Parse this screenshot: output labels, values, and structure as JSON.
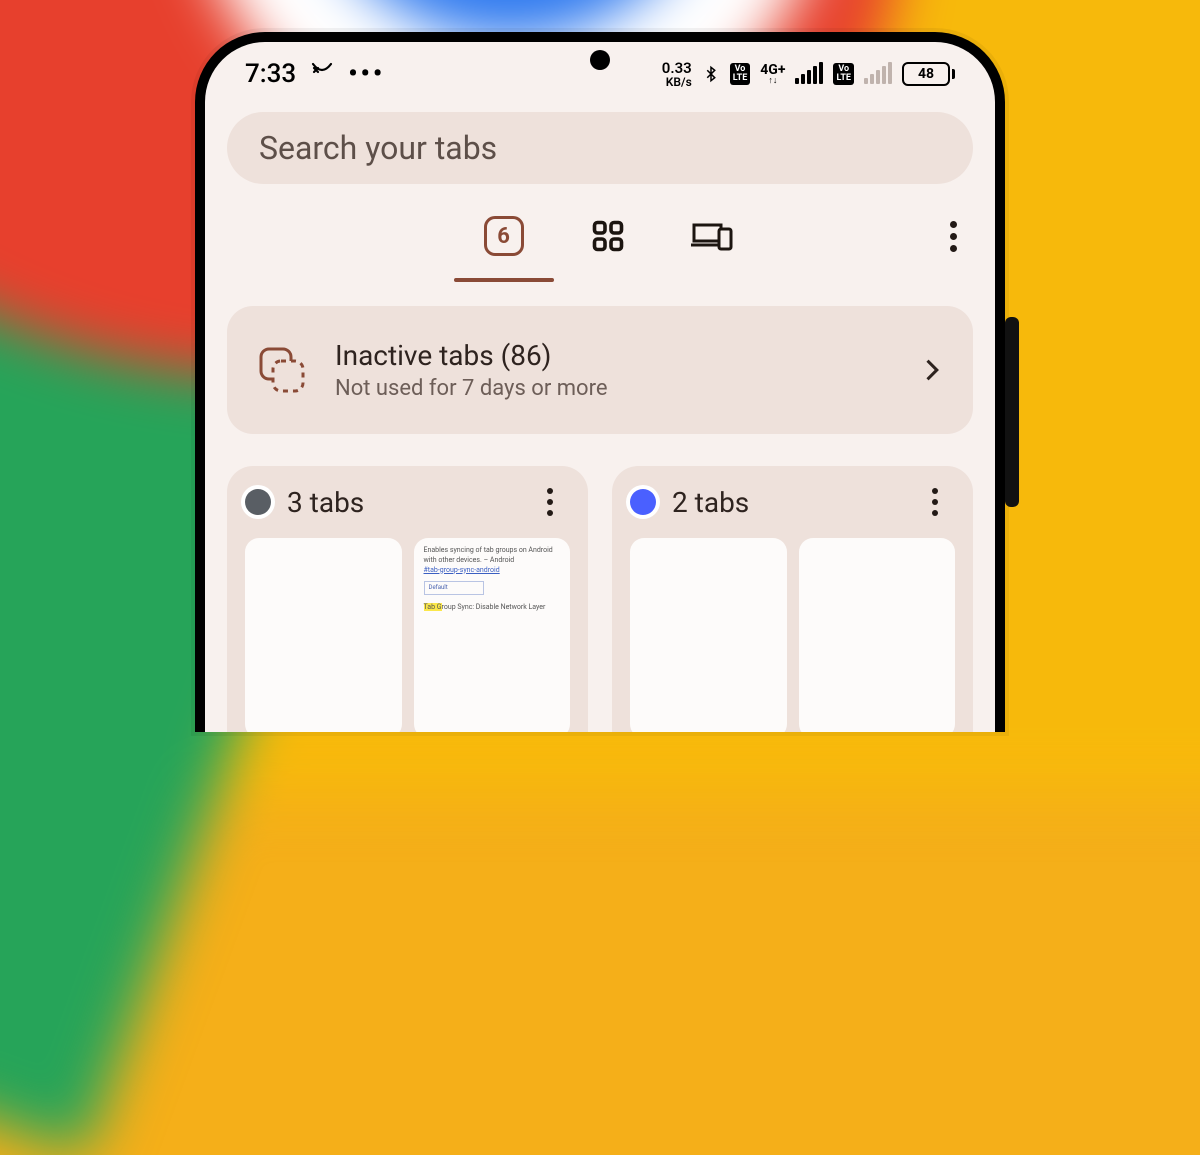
{
  "status": {
    "time": "7:33",
    "data_rate_value": "0.33",
    "data_rate_unit": "KB/s",
    "network_label": "4G+",
    "volte_label_top": "Vo",
    "volte_label_bottom": "LTE",
    "battery_percent": "48"
  },
  "search": {
    "placeholder": "Search your tabs"
  },
  "tabs": {
    "count": "6"
  },
  "inactive": {
    "title": "Inactive tabs (86)",
    "subtitle": "Not used for 7 days or more"
  },
  "groups": [
    {
      "color": "#595e64",
      "label": "3 tabs"
    },
    {
      "color": "#4a60ff",
      "label": "2 tabs"
    }
  ],
  "thumb_preview": {
    "line1": "Enables syncing of tab groups on Android with other devices. – Android",
    "line2": "#tab-group-sync-android",
    "select": "Default",
    "line3_hl": "Tab G",
    "line3_rest": "roup Sync: Disable Network Layer"
  }
}
